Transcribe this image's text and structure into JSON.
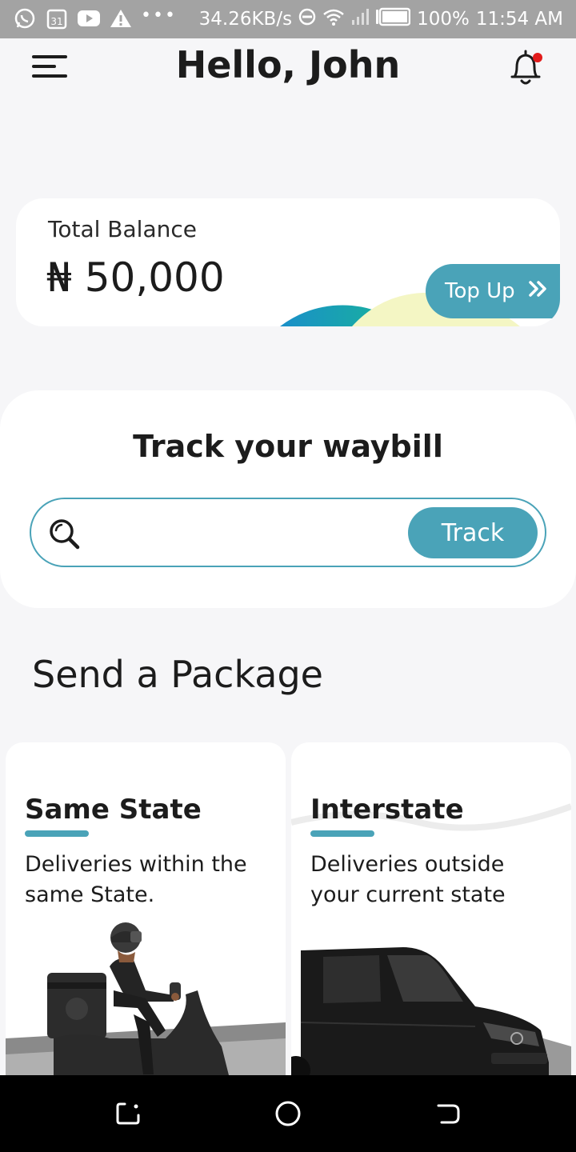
{
  "status_bar": {
    "calendar_day": "31",
    "dots": "•••",
    "speed": "34.26KB/s",
    "battery": "100%",
    "time": "11:54 AM",
    "icons": [
      "whatsapp-icon",
      "calendar-icon",
      "youtube-icon",
      "warning-icon",
      "dnd-icon",
      "wifi-icon",
      "signal-icon",
      "battery-icon"
    ]
  },
  "header": {
    "greeting": "Hello, John",
    "menu_icon": "hamburger-menu-icon",
    "bell_icon": "bell-icon",
    "has_notification": true
  },
  "balance": {
    "label": "Total Balance",
    "amount": "₦ 50,000",
    "topup_label": "Top Up",
    "topup_icon": "double-chevron-right-icon"
  },
  "track": {
    "title": "Track your waybill",
    "input_value": "",
    "button_label": "Track",
    "search_icon": "search-icon"
  },
  "send": {
    "title": "Send a Package",
    "cards": [
      {
        "title": "Same State",
        "description": "Deliveries within the same State.",
        "image": "scooter-rider-illustration"
      },
      {
        "title": "Interstate",
        "description": "Deliveries outside your current state",
        "image": "delivery-van-illustration"
      }
    ]
  },
  "nav_bar": {
    "icons": [
      "recents-icon",
      "home-icon",
      "back-icon"
    ]
  },
  "colors": {
    "accent": "#4aa3b8",
    "background": "#f6f6f8",
    "text": "#1c1c1c",
    "notification": "#e21b1b",
    "status_bar": "#a3a3a3"
  }
}
